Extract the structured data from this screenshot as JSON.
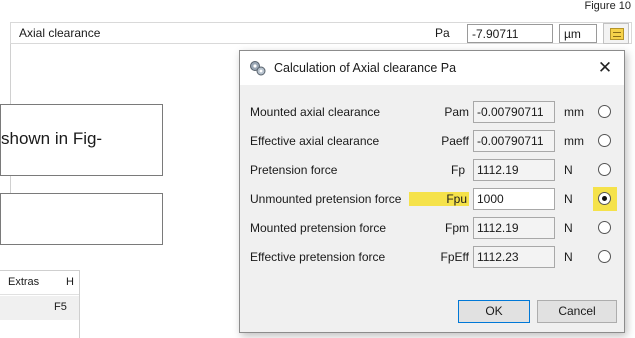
{
  "figure_label": "Figure 10",
  "parameter": {
    "label": "Axial clearance",
    "symbol": "Pa",
    "value": "-7.90711",
    "unit": "µm"
  },
  "document_text": {
    "fragment": "shown in Fig-"
  },
  "menu": {
    "items": [
      "Extras",
      "H"
    ],
    "shortcut": "F5"
  },
  "dialog": {
    "title": "Calculation of Axial clearance Pa",
    "close": "✕",
    "rows": [
      {
        "label": "Mounted axial clearance",
        "symbol": "Pam",
        "value": "-0.00790711",
        "unit": "mm",
        "selected": false,
        "highlight": false
      },
      {
        "label": "Effective axial clearance",
        "symbol": "Paeff",
        "value": "-0.00790711",
        "unit": "mm",
        "selected": false,
        "highlight": false
      },
      {
        "label": "Pretension force",
        "symbol": "Fp",
        "value": "1112.19",
        "unit": "N",
        "selected": false,
        "highlight": false
      },
      {
        "label": "Unmounted pretension force",
        "symbol": "Fpu",
        "value": "1000",
        "unit": "N",
        "selected": true,
        "highlight": true
      },
      {
        "label": "Mounted pretension force",
        "symbol": "Fpm",
        "value": "1112.19",
        "unit": "N",
        "selected": false,
        "highlight": false
      },
      {
        "label": "Effective pretension force",
        "symbol": "FpEff",
        "value": "1112.23",
        "unit": "N",
        "selected": false,
        "highlight": false
      }
    ],
    "ok_label": "OK",
    "cancel_label": "Cancel"
  },
  "colors": {
    "highlight": "#f5e24a",
    "dialog_bg": "#f0f0f0",
    "ok_border": "#0078d7"
  }
}
